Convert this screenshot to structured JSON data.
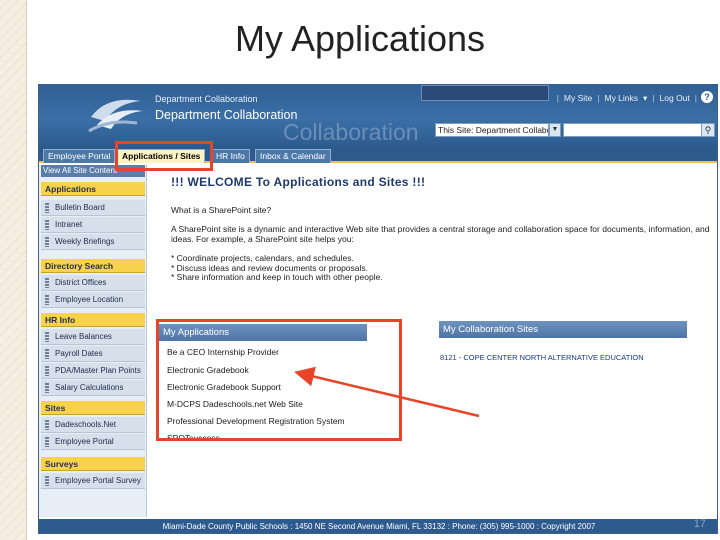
{
  "slide": {
    "title": "My Applications",
    "number": "17"
  },
  "header": {
    "breadcrumb": "Department Collaboration",
    "site_title": "Department Collaboration",
    "watermark": "Collaboration",
    "links": [
      "My Site",
      "My Links"
    ],
    "logout": "Log Out",
    "search_scope": "This Site: Department Collabor"
  },
  "tabs": [
    {
      "label": "Employee Portal",
      "active": false
    },
    {
      "label": "Applications / Sites",
      "active": true
    },
    {
      "label": "HR Info",
      "active": false
    },
    {
      "label": "Inbox & Calendar",
      "active": false
    }
  ],
  "sidebar": {
    "view_all": "View All Site Content",
    "sections": [
      {
        "heading": "Applications",
        "items": [
          "Bulletin Board",
          "Intranet",
          "Weekly Briefings"
        ]
      },
      {
        "heading": "Directory Search",
        "items": [
          "District Offices",
          "Employee Location"
        ]
      },
      {
        "heading": "HR Info",
        "items": [
          "Leave Balances",
          "Payroll Dates",
          "PDA/Master Plan Points",
          "Salary Calculations"
        ]
      },
      {
        "heading": "Sites",
        "items": [
          "Dadeschools.Net",
          "Employee Portal"
        ]
      },
      {
        "heading": "Surveys",
        "items": [
          "Employee Portal Survey"
        ]
      }
    ]
  },
  "main": {
    "welcome": "!!! WELCOME  To Applications and Sites !!!",
    "question": "What is a SharePoint site?",
    "paragraph": "A SharePoint site is a dynamic and interactive Web site that provides a central storage and collaboration space for documents, information, and ideas. For example, a SharePoint site helps you:",
    "bullets": [
      "* Coordinate projects, calendars, and schedules.",
      "* Discuss ideas and review documents or proposals.",
      "* Share information and keep in touch with other people."
    ],
    "my_applications": {
      "heading": "My Applications",
      "items": [
        "Be a CEO Internship Provider",
        "Electronic Gradebook",
        "Electronic Gradebook Support",
        "M-DCPS Dadeschools.net Web Site",
        "Professional Development Registration System",
        "SPOTsuccess"
      ]
    },
    "collab_sites": {
      "heading": "My Collaboration Sites",
      "link": "8121 - COPE CENTER NORTH ALTERNATIVE EDUCATION"
    }
  },
  "footer": "Miami-Dade County Public Schools : 1450 NE Second Avenue   Miami, FL 33132 : Phone: (305) 995-1000 : Copyright 2007",
  "colors": {
    "header_blue": "#2f5f95",
    "nav_heading": "#f9d24b",
    "highlight_red": "#e8442a"
  }
}
